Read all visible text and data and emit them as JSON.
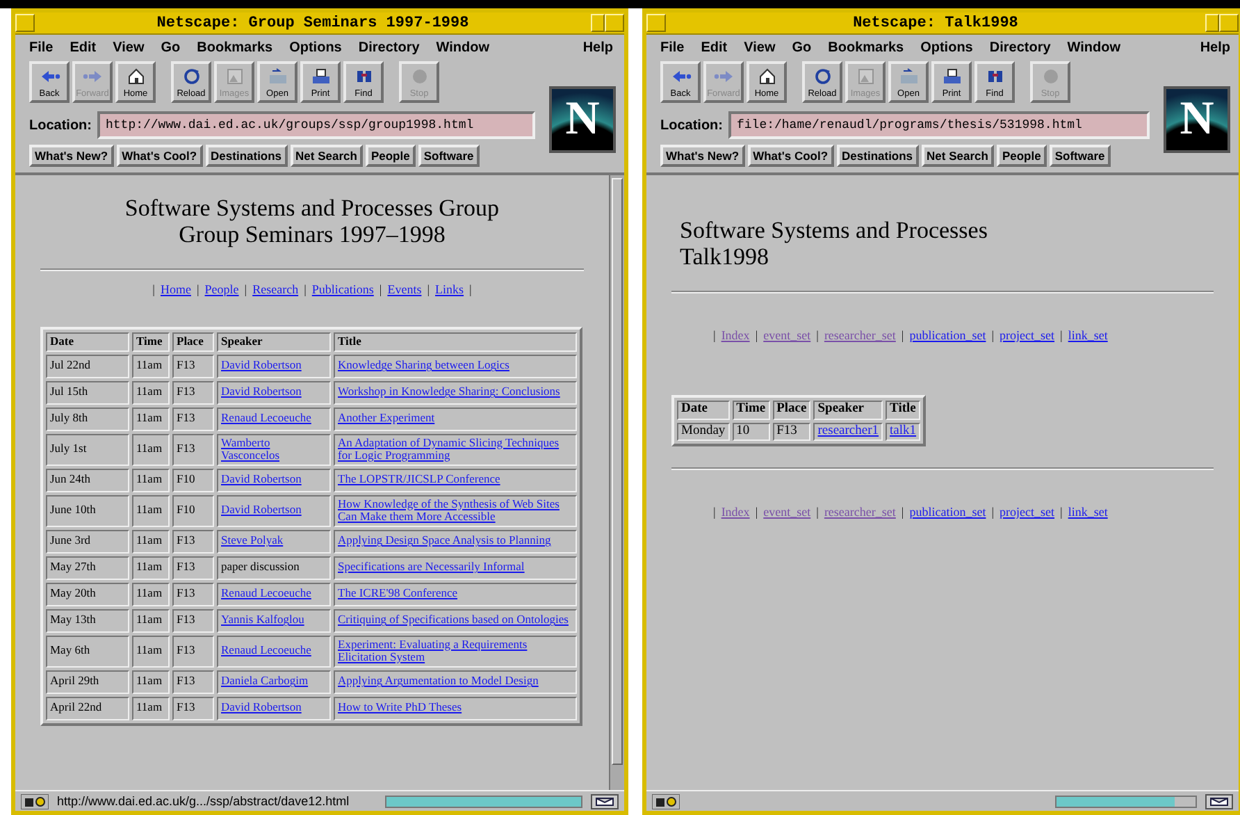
{
  "windows": [
    {
      "title": "Netscape: Group Seminars 1997-1998",
      "menu": [
        "File",
        "Edit",
        "View",
        "Go",
        "Bookmarks",
        "Options",
        "Directory",
        "Window"
      ],
      "help": "Help",
      "toolbar": [
        {
          "kind": "back",
          "label": "Back",
          "disabled": false
        },
        {
          "kind": "forward",
          "label": "Forward",
          "disabled": true
        },
        {
          "kind": "home",
          "label": "Home",
          "disabled": false
        },
        {
          "kind": "reload",
          "label": "Reload",
          "disabled": false
        },
        {
          "kind": "images",
          "label": "Images",
          "disabled": true
        },
        {
          "kind": "open",
          "label": "Open",
          "disabled": false
        },
        {
          "kind": "print",
          "label": "Print",
          "disabled": false
        },
        {
          "kind": "find",
          "label": "Find",
          "disabled": false
        },
        {
          "kind": "stop",
          "label": "Stop",
          "disabled": true
        }
      ],
      "logo_letter": "N",
      "location_label": "Location:",
      "url": "http://www.dai.ed.ac.uk/groups/ssp/group1998.html",
      "directory": [
        "What's New?",
        "What's Cool?",
        "Destinations",
        "Net Search",
        "People",
        "Software"
      ],
      "content": {
        "kind": "seminars",
        "heading": [
          "Software Systems and Processes Group",
          "Group Seminars 1997–1998"
        ],
        "navs": [
          {
            "separator": "|",
            "links": [
              {
                "text": "Home",
                "visited": false
              },
              {
                "text": "People",
                "visited": false
              },
              {
                "text": "Research",
                "visited": false
              },
              {
                "text": "Publications",
                "visited": false
              },
              {
                "text": "Events",
                "visited": false
              },
              {
                "text": "Links",
                "visited": false
              }
            ]
          }
        ],
        "columns": [
          "Date",
          "Time",
          "Place",
          "Speaker",
          "Title"
        ],
        "rows": [
          {
            "date": "Jul 22nd",
            "time": "11am",
            "place": "F13",
            "speaker": {
              "text": "David Robertson",
              "link": true
            },
            "title": "Knowledge Sharing between Logics"
          },
          {
            "date": "Jul 15th",
            "time": "11am",
            "place": "F13",
            "speaker": {
              "text": "David Robertson",
              "link": true
            },
            "title": "Workshop in Knowledge Sharing: Conclusions"
          },
          {
            "date": "July 8th",
            "time": "11am",
            "place": "F13",
            "speaker": {
              "text": "Renaud Lecoeuche",
              "link": true
            },
            "title": "Another Experiment"
          },
          {
            "date": "July 1st",
            "time": "11am",
            "place": "F13",
            "speaker": {
              "text": "Wamberto Vasconcelos",
              "link": true
            },
            "title": "An Adaptation of Dynamic Slicing Techniques for Logic Programming"
          },
          {
            "date": "Jun 24th",
            "time": "11am",
            "place": "F10",
            "speaker": {
              "text": "David Robertson",
              "link": true
            },
            "title": "The LOPSTR/JICSLP Conference"
          },
          {
            "date": "June 10th",
            "time": "11am",
            "place": "F10",
            "speaker": {
              "text": "David Robertson",
              "link": true
            },
            "title": "How Knowledge of the Synthesis of Web Sites Can Make them More Accessible"
          },
          {
            "date": "June 3rd",
            "time": "11am",
            "place": "F13",
            "speaker": {
              "text": "Steve Polyak",
              "link": true
            },
            "title": "Applying Design Space Analysis to Planning"
          },
          {
            "date": "May 27th",
            "time": "11am",
            "place": "F13",
            "speaker": {
              "text": "paper discussion",
              "link": false
            },
            "title": "Specifications are Necessarily Informal"
          },
          {
            "date": "May 20th",
            "time": "11am",
            "place": "F13",
            "speaker": {
              "text": "Renaud Lecoeuche",
              "link": true
            },
            "title": "The ICRE'98 Conference"
          },
          {
            "date": "May 13th",
            "time": "11am",
            "place": "F13",
            "speaker": {
              "text": "Yannis Kalfoglou",
              "link": true
            },
            "title": "Critiquing of Specifications based on Ontologies"
          },
          {
            "date": "May 6th",
            "time": "11am",
            "place": "F13",
            "speaker": {
              "text": "Renaud Lecoeuche",
              "link": true
            },
            "title": "Experiment: Evaluating a Requirements Elicitation System"
          },
          {
            "date": "April 29th",
            "time": "11am",
            "place": "F13",
            "speaker": {
              "text": "Daniela Carbogim",
              "link": true
            },
            "title": "Applying Argumentation to Model Design"
          },
          {
            "date": "April 22nd",
            "time": "11am",
            "place": "F13",
            "speaker": {
              "text": "David Robertson",
              "link": true
            },
            "title": "How to Write PhD Theses"
          }
        ]
      },
      "status": {
        "text": "http://www.dai.ed.ac.uk/g.../ssp/abstract/dave12.html",
        "level": 1
      }
    },
    {
      "title": "Netscape: Talk1998",
      "menu": [
        "File",
        "Edit",
        "View",
        "Go",
        "Bookmarks",
        "Options",
        "Directory",
        "Window"
      ],
      "help": "Help",
      "toolbar": [
        {
          "kind": "back",
          "label": "Back",
          "disabled": false
        },
        {
          "kind": "forward",
          "label": "Forward",
          "disabled": true
        },
        {
          "kind": "home",
          "label": "Home",
          "disabled": false
        },
        {
          "kind": "reload",
          "label": "Reload",
          "disabled": false
        },
        {
          "kind": "images",
          "label": "Images",
          "disabled": true
        },
        {
          "kind": "open",
          "label": "Open",
          "disabled": false
        },
        {
          "kind": "print",
          "label": "Print",
          "disabled": false
        },
        {
          "kind": "find",
          "label": "Find",
          "disabled": false
        },
        {
          "kind": "stop",
          "label": "Stop",
          "disabled": true
        }
      ],
      "logo_letter": "N",
      "location_label": "Location:",
      "url": "file:/hame/renaudl/programs/thesis/531998.html",
      "directory": [
        "What's New?",
        "What's Cool?",
        "Destinations",
        "Net Search",
        "People",
        "Software"
      ],
      "content": {
        "kind": "talk",
        "heading": [
          "Software Systems and Processes",
          "Talk1998"
        ],
        "navs": [
          {
            "separator": "|",
            "links": [
              {
                "text": "Index",
                "visited": true
              },
              {
                "text": "event_set",
                "visited": true
              },
              {
                "text": "researcher_set",
                "visited": true
              },
              {
                "text": "publication_set",
                "visited": false
              },
              {
                "text": "project_set",
                "visited": false
              },
              {
                "text": "link_set",
                "visited": false
              }
            ]
          },
          {
            "separator": "|",
            "links": [
              {
                "text": "Index",
                "visited": true
              },
              {
                "text": "event_set",
                "visited": true
              },
              {
                "text": "researcher_set",
                "visited": true
              },
              {
                "text": "publication_set",
                "visited": false
              },
              {
                "text": "project_set",
                "visited": false
              },
              {
                "text": "link_set",
                "visited": false
              }
            ]
          }
        ],
        "columns": [
          "Date",
          "Time",
          "Place",
          "Speaker",
          "Title"
        ],
        "rows": [
          {
            "date": "Monday",
            "time": "10",
            "place": "F13",
            "speaker": {
              "text": "researcher1",
              "link": true
            },
            "title": "talk1"
          }
        ]
      },
      "status": {
        "level": 0.85
      }
    }
  ]
}
